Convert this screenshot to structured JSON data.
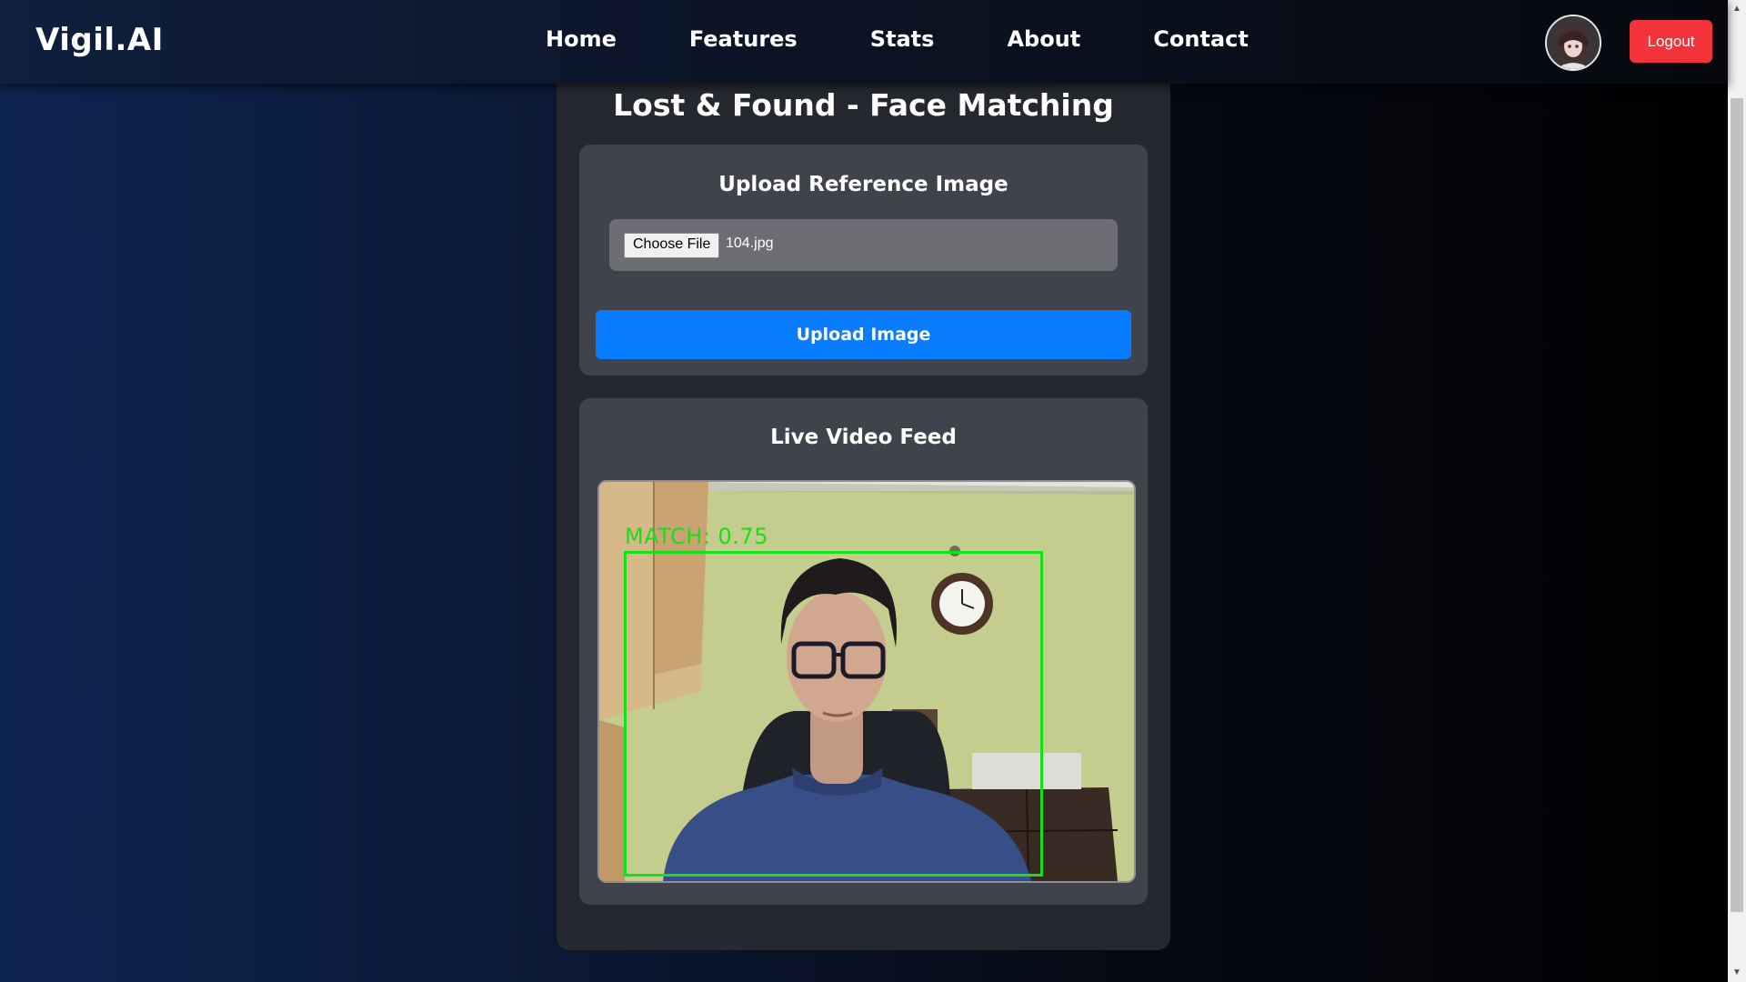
{
  "brand": "Vigil.AI",
  "nav": {
    "links": [
      "Home",
      "Features",
      "Stats",
      "About",
      "Contact"
    ],
    "logout_label": "Logout"
  },
  "main": {
    "title": "Lost & Found - Face Matching",
    "upload_panel": {
      "title": "Upload Reference Image",
      "choose_file_label": "Choose File",
      "file_name": "104.jpg",
      "upload_button_label": "Upload Image"
    },
    "video_panel": {
      "title": "Live Video Feed",
      "match_label": "MATCH: 0.75"
    }
  },
  "colors": {
    "accent_blue": "#0a7cff",
    "logout_red": "#f2333a",
    "match_green": "#17e017"
  }
}
